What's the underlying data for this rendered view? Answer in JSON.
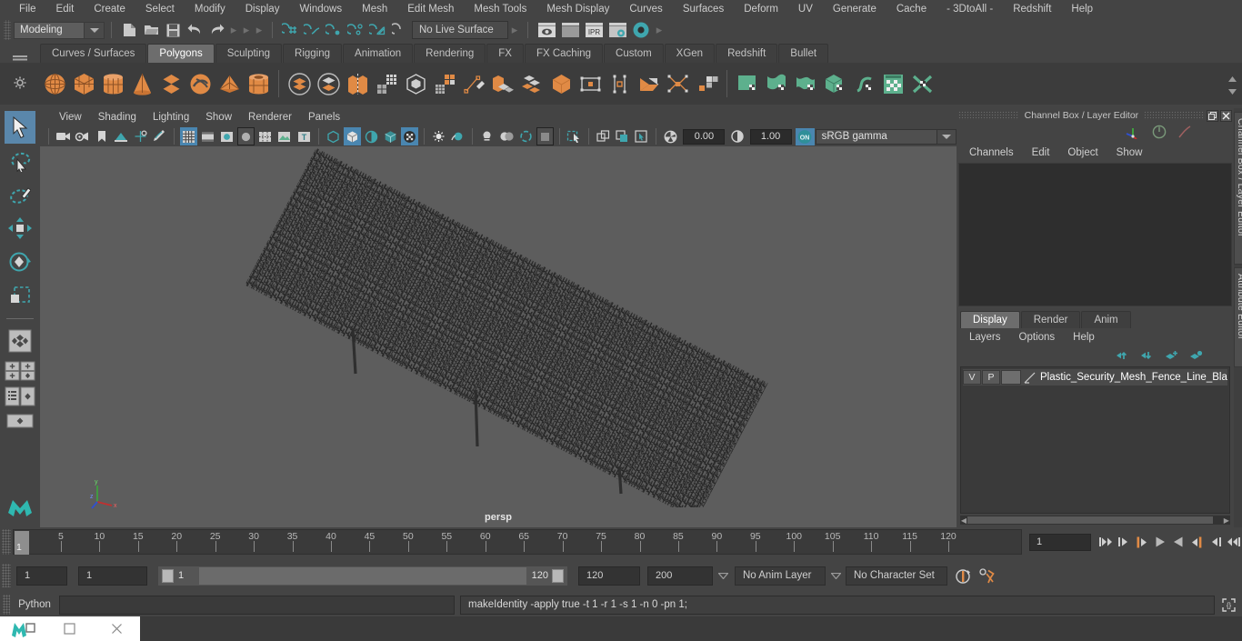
{
  "menubar": {
    "items": [
      "File",
      "Edit",
      "Create",
      "Select",
      "Modify",
      "Display",
      "Windows",
      "Mesh",
      "Edit Mesh",
      "Mesh Tools",
      "Mesh Display",
      "Curves",
      "Surfaces",
      "Deform",
      "UV",
      "Generate",
      "Cache",
      "- 3DtoAll -",
      "Redshift",
      "Help"
    ]
  },
  "statusline": {
    "menuset": "Modeling",
    "live_surface": "No Live Surface"
  },
  "shelf": {
    "tabs": [
      "Curves / Surfaces",
      "Polygons",
      "Sculpting",
      "Rigging",
      "Animation",
      "Rendering",
      "FX",
      "FX Caching",
      "Custom",
      "XGen",
      "Redshift",
      "Bullet"
    ],
    "active_tab": "Polygons"
  },
  "viewport": {
    "menus": [
      "View",
      "Shading",
      "Lighting",
      "Show",
      "Renderer",
      "Panels"
    ],
    "exposure": "0.00",
    "gamma": "1.00",
    "color_space": "sRGB gamma",
    "camera_label": "persp",
    "axis": {
      "x": "x",
      "y": "y",
      "z": "z"
    },
    "bg_color": "#5d5d5d"
  },
  "channel_box": {
    "title": "Channel Box / Layer Editor",
    "menus": [
      "Channels",
      "Edit",
      "Object",
      "Show"
    ]
  },
  "layer_editor": {
    "tabs": [
      "Display",
      "Render",
      "Anim"
    ],
    "active_tab": "Display",
    "menus": [
      "Layers",
      "Options",
      "Help"
    ],
    "layers": [
      {
        "visibility": "V",
        "playback": "P",
        "color": "",
        "name": "Plastic_Security_Mesh_Fence_Line_Bla"
      }
    ]
  },
  "right_tabs": [
    "Channel Box / Layer Editor",
    "Attribute Editor"
  ],
  "timeline": {
    "start": 1,
    "end": 120,
    "current_frame": "1",
    "frame_field": "1",
    "tick_labels": [
      5,
      10,
      15,
      20,
      25,
      30,
      35,
      40,
      45,
      50,
      55,
      60,
      65,
      70,
      75,
      80,
      85,
      90,
      95,
      100,
      105,
      110,
      115,
      120
    ]
  },
  "range_slider": {
    "anim_start": "1",
    "range_start": "1",
    "slider_left": "1",
    "slider_right": "120",
    "range_end": "120",
    "anim_end": "200",
    "anim_layer": "No Anim Layer",
    "character_set": "No Character Set"
  },
  "command_line": {
    "language": "Python",
    "input_value": "",
    "result": "makeIdentity -apply true -t 1 -r 1 -s 1 -n 0 -pn 1;"
  },
  "colors": {
    "accent_orange": "#e08a45",
    "accent_teal": "#3fa6ae",
    "accent_green": "#5db08d",
    "selected_blue": "#5a87ab",
    "panel_bg": "#444444",
    "viewport_bg": "#5d5d5d"
  }
}
